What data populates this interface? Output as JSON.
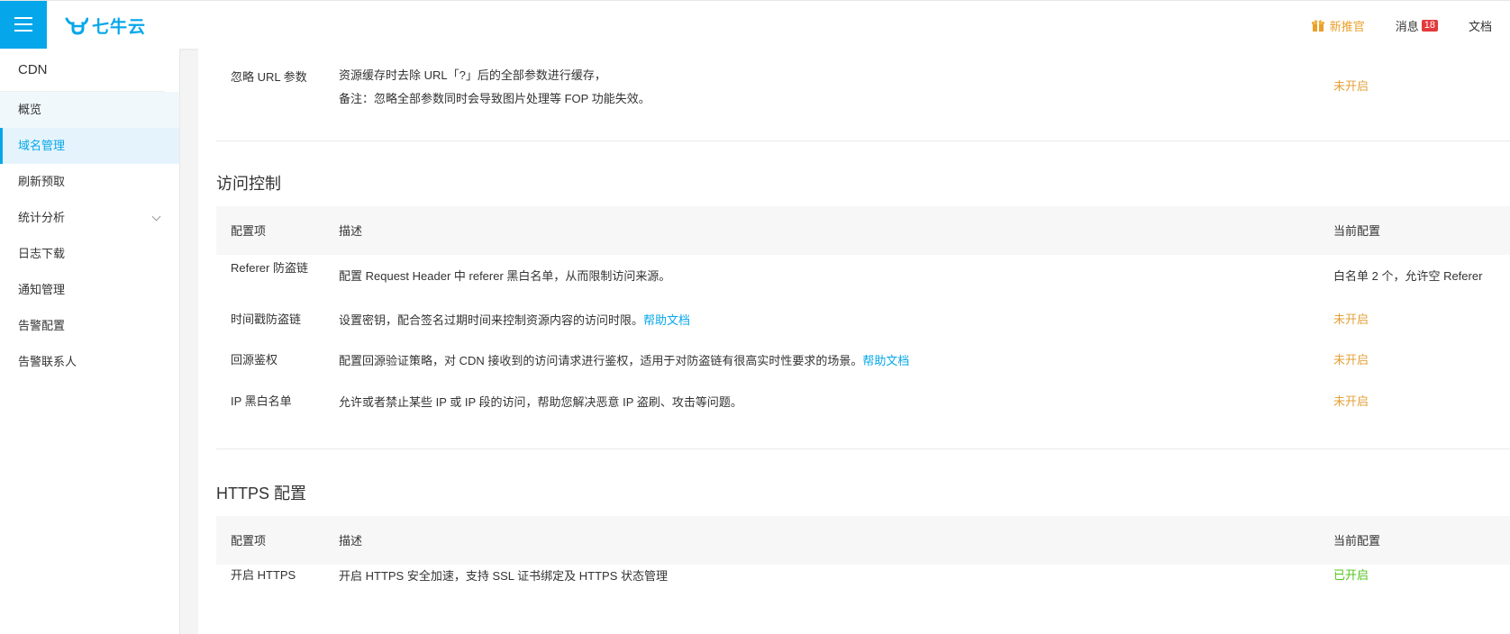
{
  "header": {
    "logo_text": "七牛云",
    "promo_label": "新推官",
    "messages_label": "消息",
    "messages_count": "18",
    "docs_label": "文档",
    "accent_color": "#06a7ea"
  },
  "sidebar": {
    "title": "CDN",
    "items": [
      {
        "label": "概览"
      },
      {
        "label": "域名管理"
      },
      {
        "label": "刷新预取"
      },
      {
        "label": "统计分析"
      },
      {
        "label": "日志下载"
      },
      {
        "label": "通知管理"
      },
      {
        "label": "告警配置"
      },
      {
        "label": "告警联系人"
      }
    ]
  },
  "main": {
    "ignore_url": {
      "name": "忽略 URL 参数",
      "desc_line1": "资源缓存时去除 URL「?」后的全部参数进行缓存，",
      "desc_line2": "备注：忽略全部参数同时会导致图片处理等 FOP 功能失效。",
      "status": "未开启"
    },
    "access_control": {
      "title": "访问控制",
      "header": {
        "col1": "配置项",
        "col2": "描述",
        "col3": "当前配置"
      },
      "rows": [
        {
          "name": "Referer 防盗链",
          "desc": "配置 Request Header 中 referer 黑白名单，从而限制访问来源。",
          "link": "",
          "status": "白名单 2 个，允许空 Referer"
        },
        {
          "name": "时间戳防盗链",
          "desc": "设置密钥，配合签名过期时间来控制资源内容的访问时限。",
          "link": "帮助文档",
          "status": "未开启"
        },
        {
          "name": "回源鉴权",
          "desc": "配置回源验证策略，对 CDN 接收到的访问请求进行鉴权，适用于对防盗链有很高实时性要求的场景。",
          "link": "帮助文档",
          "status": "未开启"
        },
        {
          "name": "IP 黑白名单",
          "desc": "允许或者禁止某些 IP 或 IP 段的访问，帮助您解决恶意 IP 盗刷、攻击等问题。",
          "link": "",
          "status": "未开启"
        }
      ]
    },
    "https": {
      "title": "HTTPS 配置",
      "header": {
        "col1": "配置项",
        "col2": "描述",
        "col3": "当前配置"
      },
      "rows": [
        {
          "name": "开启 HTTPS",
          "desc": "开启 HTTPS 安全加速，支持 SSL 证书绑定及 HTTPS 状态管理",
          "status": "已开启"
        }
      ]
    }
  }
}
